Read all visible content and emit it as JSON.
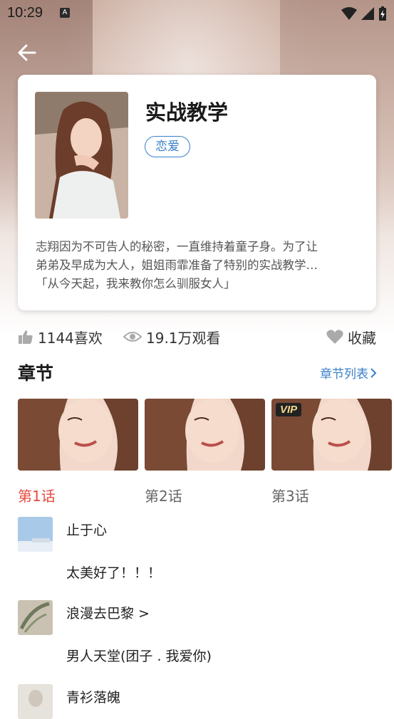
{
  "status": {
    "time": "10:29",
    "badge": "A"
  },
  "book": {
    "title": "实战教学",
    "tag": "恋爱",
    "description_lines": [
      "志翔因为不可告人的秘密，一直维持着童子身。为了让",
      "弟弟及早成为大人，姐姐雨霏准备了特别的实战教学…",
      "「从今天起，我来教你怎么驯服女人」"
    ]
  },
  "stats": {
    "likes": "1144喜欢",
    "views": "19.1万观看",
    "favorite": "收藏"
  },
  "chapters": {
    "title": "章节",
    "list_link": "章节列表",
    "items": [
      {
        "label": "第1话",
        "vip": ""
      },
      {
        "label": "第2话",
        "vip": ""
      },
      {
        "label": "第3话",
        "vip": "VIP"
      }
    ]
  },
  "comments": [
    {
      "user": "止于心",
      "text": "太美好了！！！"
    },
    {
      "user": "浪漫去巴黎 >",
      "text": "男人天堂(团子 . 我爱你)"
    },
    {
      "user": "青衫落魄",
      "text": ""
    }
  ],
  "colors": {
    "accent": "#3a7fc8",
    "active_chapter": "#e84a3f"
  }
}
